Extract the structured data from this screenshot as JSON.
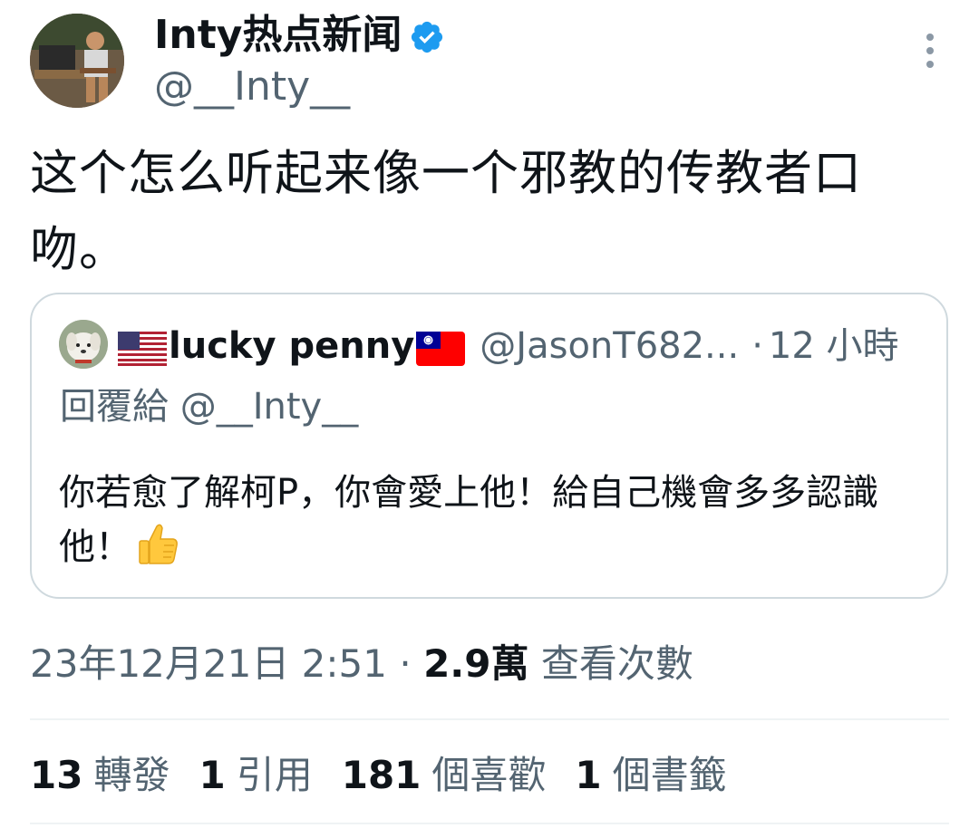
{
  "tweet": {
    "display_name": "Inty热点新闻",
    "verified_icon": "verified-badge-icon",
    "handle": "@__Inty__",
    "text": "这个怎么听起来像一个邪教的传教者口吻。"
  },
  "quote": {
    "flag_left": "us-flag-icon",
    "name": "lucky penny",
    "flag_right": "taiwan-flag-icon",
    "handle": "@JasonT682...",
    "dot": "·",
    "time": "12 小時",
    "replying_to": "回覆給 @__Inty__",
    "text": "你若愈了解柯P，你會愛上他！給自己機會多多認識他！",
    "emoji": "thumbs-up-icon"
  },
  "meta": {
    "datetime": "23年12月21日 2:51",
    "dot": "·",
    "views_count": "2.9萬",
    "views_label": "查看次數"
  },
  "stats": [
    {
      "num": "13",
      "label": "轉發"
    },
    {
      "num": "1",
      "label": "引用"
    },
    {
      "num": "181",
      "label": "個喜歡"
    },
    {
      "num": "1",
      "label": "個書籤"
    }
  ],
  "colors": {
    "text": "#0f1419",
    "secondary": "#536471",
    "border": "#cfd9de",
    "verified": "#1d9bf0"
  }
}
